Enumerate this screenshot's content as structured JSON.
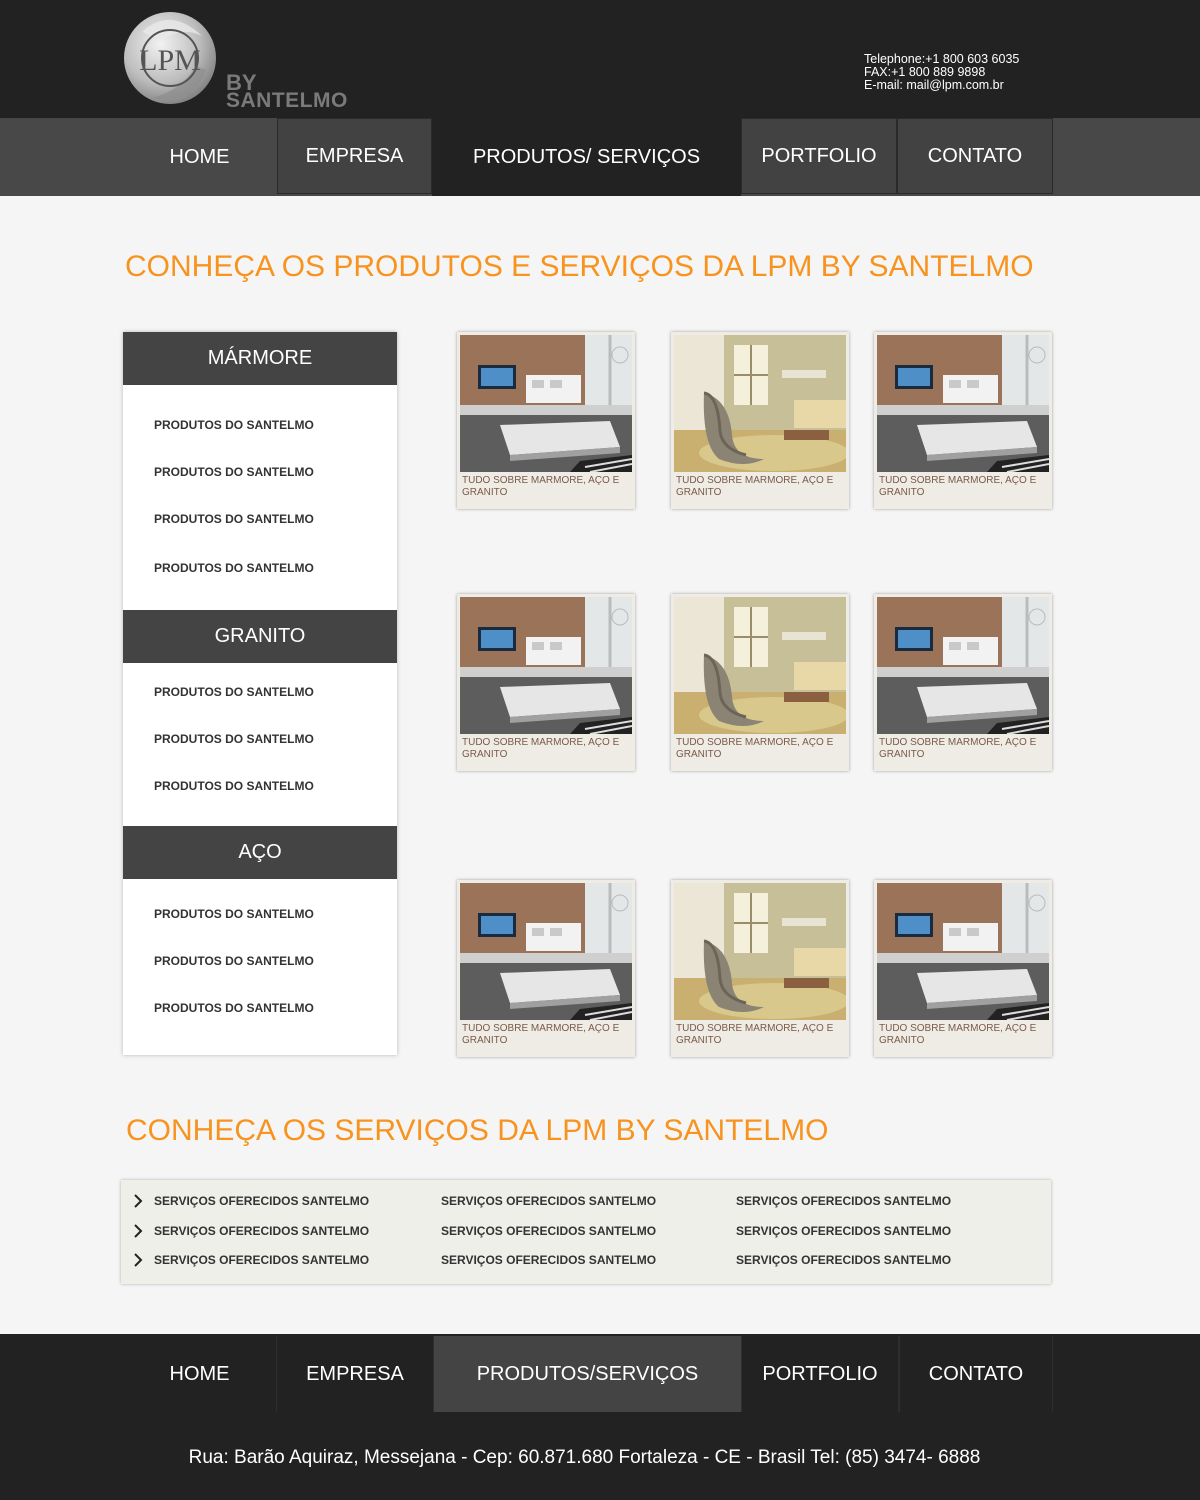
{
  "brand": {
    "logo_letters": "LPM",
    "logo_by": "BY",
    "logo_name": "SANTELMO"
  },
  "contact": {
    "telephone": "Telephone:+1 800 603 6035",
    "fax": "FAX:+1 800 889 9898",
    "email": "E-mail: mail@lpm.com.br"
  },
  "nav": {
    "items": [
      {
        "label": "HOME"
      },
      {
        "label": "EMPRESA"
      },
      {
        "label": "PRODUTOS/ SERVIÇOS",
        "active": true
      },
      {
        "label": "PORTFOLIO"
      },
      {
        "label": "CONTATO"
      }
    ]
  },
  "products": {
    "title": "CONHEÇA OS PRODUTOS E SERVIÇOS DA LPM BY SANTELMO",
    "categories": [
      {
        "name": "MÁRMORE",
        "links": [
          "PRODUTOS DO SANTELMO",
          "PRODUTOS DO SANTELMO",
          "PRODUTOS DO SANTELMO",
          "PRODUTOS DO SANTELMO"
        ]
      },
      {
        "name": "GRANITO",
        "links": [
          "PRODUTOS DO SANTELMO",
          "PRODUTOS DO SANTELMO",
          "PRODUTOS DO SANTELMO"
        ]
      },
      {
        "name": "AÇO",
        "links": [
          "PRODUTOS DO SANTELMO",
          "PRODUTOS DO SANTELMO",
          "PRODUTOS DO SANTELMO"
        ]
      }
    ],
    "cards": [
      {
        "caption": "TUDO SOBRE MARMORE, AÇO E GRANITO",
        "image": "living-room-tv"
      },
      {
        "caption": "TUDO SOBRE MARMORE, AÇO E GRANITO",
        "image": "living-room-chair"
      },
      {
        "caption": "TUDO SOBRE MARMORE, AÇO E GRANITO",
        "image": "living-room-tv"
      },
      {
        "caption": "TUDO SOBRE MARMORE, AÇO E GRANITO",
        "image": "living-room-tv"
      },
      {
        "caption": "TUDO SOBRE MARMORE, AÇO E GRANITO",
        "image": "living-room-chair"
      },
      {
        "caption": "TUDO SOBRE MARMORE, AÇO E GRANITO",
        "image": "living-room-tv"
      },
      {
        "caption": "TUDO SOBRE MARMORE, AÇO E GRANITO",
        "image": "living-room-tv"
      },
      {
        "caption": "TUDO SOBRE MARMORE, AÇO E GRANITO",
        "image": "living-room-chair"
      },
      {
        "caption": "TUDO SOBRE MARMORE, AÇO E GRANITO",
        "image": "living-room-tv"
      }
    ]
  },
  "services": {
    "title": "CONHEÇA OS SERVIÇOS DA LPM BY SANTELMO",
    "columns": [
      [
        "SERVIÇOS OFERECIDOS SANTELMO",
        "SERVIÇOS OFERECIDOS SANTELMO",
        "SERVIÇOS OFERECIDOS SANTELMO"
      ],
      [
        "SERVIÇOS OFERECIDOS SANTELMO",
        "SERVIÇOS OFERECIDOS SANTELMO",
        "SERVIÇOS OFERECIDOS SANTELMO"
      ],
      [
        "SERVIÇOS OFERECIDOS SANTELMO",
        "SERVIÇOS OFERECIDOS SANTELMO",
        "SERVIÇOS OFERECIDOS SANTELMO"
      ]
    ],
    "bullet_icon": "chevron-right-icon"
  },
  "footer": {
    "nav": [
      {
        "label": "HOME"
      },
      {
        "label": "EMPRESA"
      },
      {
        "label": "PRODUTOS/SERVIÇOS",
        "active": true
      },
      {
        "label": "PORTFOLIO"
      },
      {
        "label": "CONTATO"
      }
    ],
    "address": "Rua: Barão Aquiraz, Messejana - Cep: 60.871.680 Fortaleza - CE - Brasil Tel: (85) 3474- 6888"
  },
  "colors": {
    "accent": "#f7931e",
    "header_bg": "#222222",
    "nav_bg": "#484848",
    "category_bg": "#444444"
  }
}
